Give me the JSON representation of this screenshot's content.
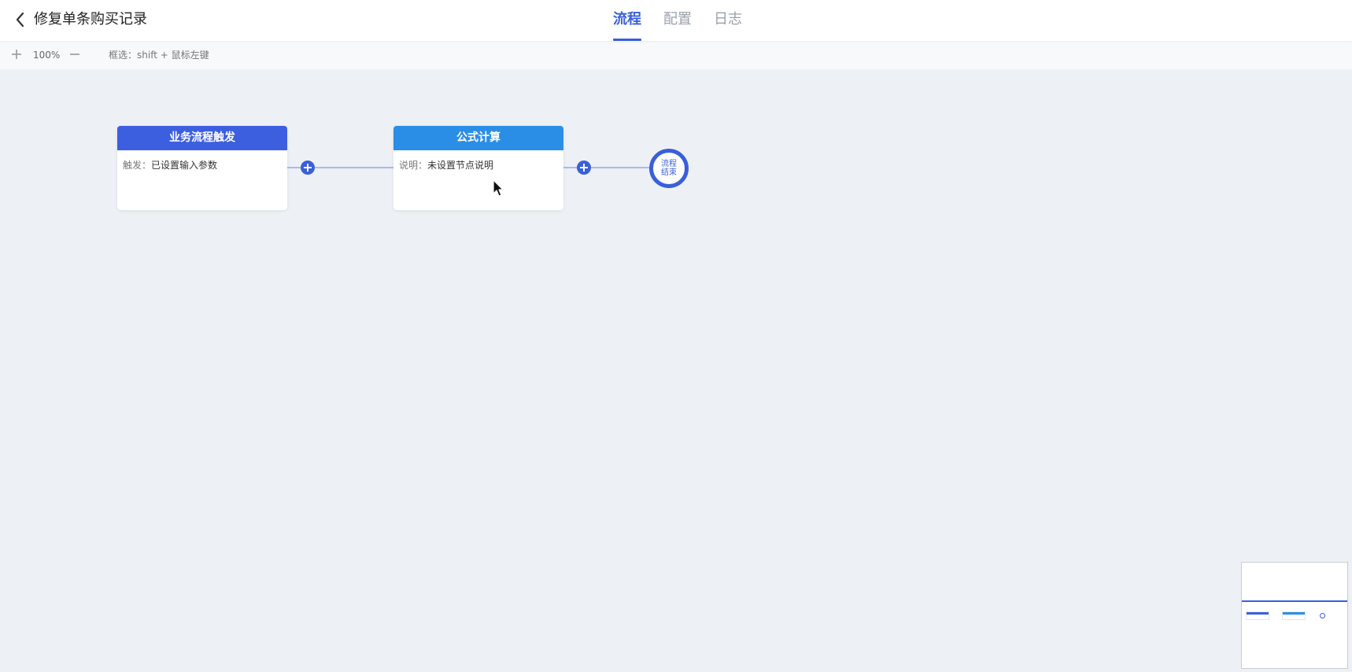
{
  "header": {
    "title": "修复单条购买记录",
    "tabs": [
      {
        "label": "流程",
        "active": true
      },
      {
        "label": "配置",
        "active": false
      },
      {
        "label": "日志",
        "active": false
      }
    ]
  },
  "toolbar": {
    "zoom_level": "100%",
    "select_hint": "框选：shift + 鼠标左键"
  },
  "flow": {
    "nodes": [
      {
        "title": "业务流程触发",
        "label": "触发：",
        "value": "已设置输入参数",
        "color": "#3c5fe0"
      },
      {
        "title": "公式计算",
        "label": "说明：",
        "value": "未设置节点说明",
        "color": "#2a8ee6"
      }
    ],
    "end_node_label": "流程结束"
  },
  "colors": {
    "accent": "#3a5fd9",
    "canvas_bg": "#edf0f5"
  }
}
